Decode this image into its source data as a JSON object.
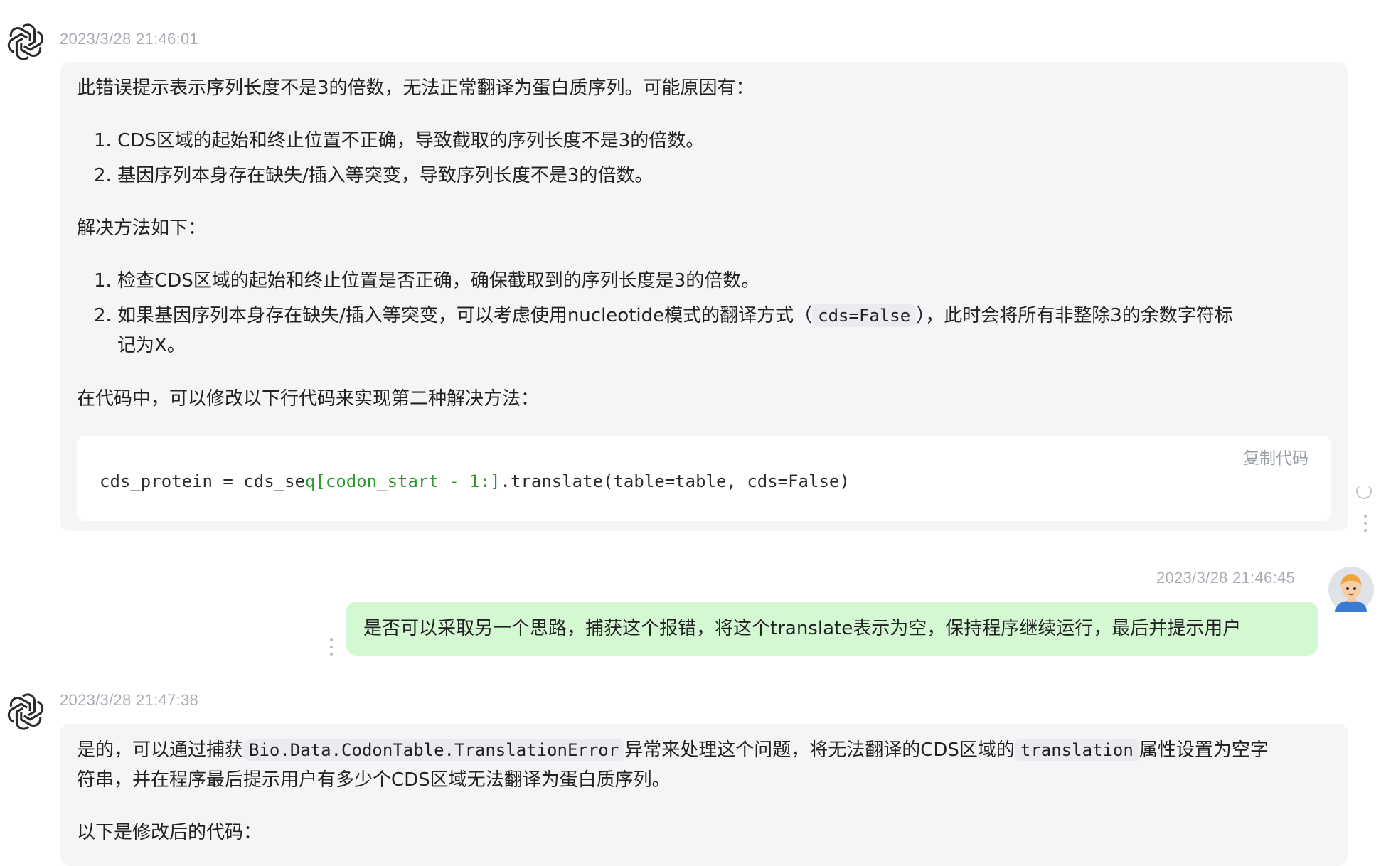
{
  "messages": {
    "bot1": {
      "timestamp": "2023/3/28 21:46:01",
      "intro": "此错误提示表示序列长度不是3的倍数，无法正常翻译为蛋白质序列。可能原因有：",
      "causes": [
        "1. CDS区域的起始和终止位置不正确，导致截取的序列长度不是3的倍数。",
        "2. 基因序列本身存在缺失/插入等突变，导致序列长度不是3的倍数。"
      ],
      "solutions_heading": "解决方法如下：",
      "solution1": "1. 检查CDS区域的起始和终止位置是否正确，确保截取到的序列长度是3的倍数。",
      "solution2_part1": "2. 如果基因序列本身存在缺失/插入等突变，可以考虑使用nucleotide模式的翻译方式（",
      "solution2_code": "cds=False",
      "solution2_part2": "），此时会将所有非整除3的余数字符标",
      "solution2_line2": "记为X。",
      "code_intro": "在代码中，可以修改以下行代码来实现第二种解决方法：",
      "copy_label": "复制代码",
      "code_part1": "cds_protein = cds_se",
      "code_part2": "q[codon_start - 1:]",
      "code_part3": ".translate(table=table, cds=False)"
    },
    "user1": {
      "timestamp": "2023/3/28 21:46:45",
      "text": "是否可以采取另一个思路，捕获这个报错，将这个translate表示为空，保持程序继续运行，最后并提示用户"
    },
    "bot2": {
      "timestamp": "2023/3/28 21:47:38",
      "part1": "是的，可以通过捕获",
      "code1": "Bio.Data.CodonTable.TranslationError",
      "part2": "异常来处理这个问题，将无法翻译的CDS区域的",
      "code2": "translation",
      "part3": "属性设置为空字",
      "line2": "符串，并在程序最后提示用户有多少个CDS区域无法翻译为蛋白质序列。",
      "line3": "以下是修改后的代码："
    }
  },
  "icons": {
    "bot_avatar": "openai-logo-icon",
    "user_avatar": "user-avatar-icon",
    "refresh": "refresh-icon",
    "more": "more-vertical-icon"
  },
  "colors": {
    "user_bubble": "#d3f8d2",
    "bot_bubble": "#f4f5f7",
    "timestamp": "#a8adb4",
    "code_green": "#2e9a2e"
  }
}
